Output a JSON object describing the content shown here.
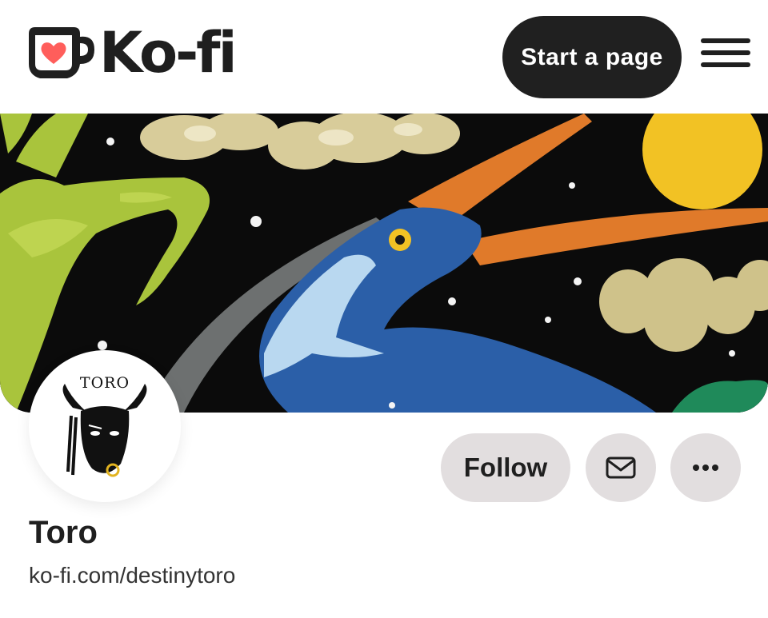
{
  "header": {
    "logo_text": "Ko-fi",
    "start_page_label": "Start a page",
    "menu_icon": "hamburger-menu-icon"
  },
  "banner": {
    "description_icon": "banner-artwork"
  },
  "profile": {
    "avatar_text": "TORO",
    "name": "Toro",
    "url": "ko-fi.com/destinytoro"
  },
  "actions": {
    "follow_label": "Follow",
    "message_icon": "envelope-icon",
    "more_icon": "more-dots-icon"
  },
  "colors": {
    "accent": "#ff5e5b",
    "dark": "#202020",
    "button_bg": "#e2dedf"
  }
}
